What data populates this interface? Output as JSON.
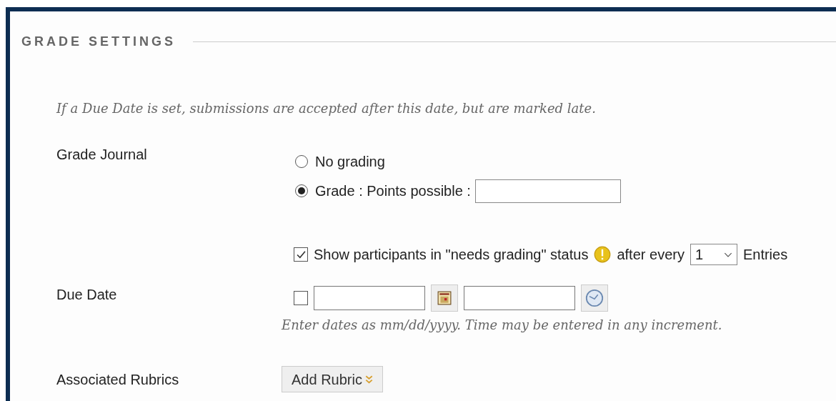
{
  "section": {
    "title": "GRADE SETTINGS"
  },
  "intro": "If a Due Date is set, submissions are accepted after this date, but are marked late.",
  "grade_journal": {
    "label": "Grade Journal",
    "options": [
      {
        "label": "No grading",
        "selected": false
      },
      {
        "label": "Grade : Points possible :",
        "selected": true
      }
    ],
    "needs_grading": {
      "checked": true,
      "label": "Show participants in \"needs grading\" status",
      "after_label": "after every",
      "count": "1",
      "suffix": "Entries"
    }
  },
  "due_date": {
    "label": "Due Date",
    "checked": false,
    "hint": "Enter dates as mm/dd/yyyy. Time may be entered in any increment."
  },
  "rubrics": {
    "label": "Associated Rubrics",
    "button": "Add Rubric"
  }
}
